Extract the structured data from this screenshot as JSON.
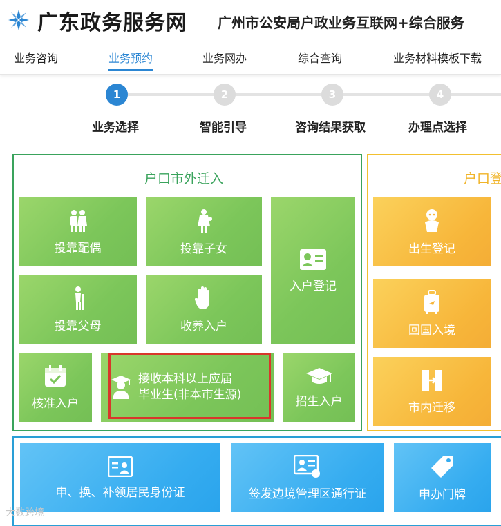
{
  "header": {
    "site_title": "广东政务服务网",
    "site_subtitle": "广州市公安局户政业务互联网+综合服务"
  },
  "nav": {
    "items": [
      "业务咨询",
      "业务预约",
      "业务网办",
      "综合查询",
      "业务材料模板下载"
    ],
    "active_index": 1
  },
  "steps": [
    {
      "number": "1",
      "label": "业务选择"
    },
    {
      "number": "2",
      "label": "智能引导"
    },
    {
      "number": "3",
      "label": "咨询结果获取"
    },
    {
      "number": "4",
      "label": "办理点选择"
    }
  ],
  "panels": {
    "green": {
      "title": "户口市外迁入",
      "tiles": {
        "spouse": "投靠配偶",
        "child": "投靠子女",
        "register": "入户登记",
        "parents": "投靠父母",
        "adopt": "收养入户",
        "approved": "核准入户",
        "graduate_line1": "接收本科以上应届",
        "graduate_line2": "毕业生(非本市生源)",
        "enroll": "招生入户"
      }
    },
    "yellow": {
      "title": "户口登",
      "tiles": {
        "birth": "出生登记",
        "return": "回国入境",
        "move": "市内迁移"
      }
    },
    "blue": {
      "tiles": {
        "id_card": "申、换、补领居民身份证",
        "border_pass": "签发边境管理区通行证",
        "door_plate": "申办门牌"
      }
    }
  },
  "watermark": "大数跨境",
  "colors": {
    "accent_blue": "#2b86d3",
    "green_border": "#3aa35c",
    "green_title": "#3aa35c",
    "yellow_border": "#f2c02f",
    "yellow_title": "#f0b429",
    "blue_border": "#2a9fd6",
    "highlight": "#d8372b"
  },
  "icons": {
    "logo": "star-logo-icon",
    "spouse": "couple-icon",
    "child": "mother-child-icon",
    "register": "id-card-icon",
    "parents": "elderly-icon",
    "adopt": "hand-icon",
    "approved": "calendar-check-icon",
    "graduate": "graduate-icon",
    "enroll": "mortarboard-icon",
    "birth": "baby-icon",
    "return": "luggage-icon",
    "move": "door-icon",
    "id_card": "id-card-icon",
    "border_pass": "pass-card-icon",
    "door_plate": "tag-icon"
  }
}
